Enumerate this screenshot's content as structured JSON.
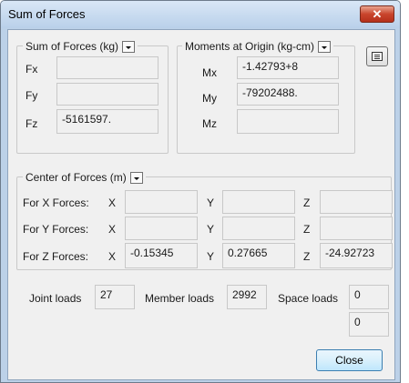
{
  "window": {
    "title": "Sum of Forces",
    "close_glyph": "✕",
    "close_button_label": "Close"
  },
  "sum_forces": {
    "title": "Sum of Forces (kg)",
    "rows": [
      {
        "label": "Fx",
        "value": ""
      },
      {
        "label": "Fy",
        "value": ""
      },
      {
        "label": "Fz",
        "value": "-5161597."
      }
    ]
  },
  "moments": {
    "title": "Moments at Origin (kg-cm)",
    "rows": [
      {
        "label": "Mx",
        "value": "-1.42793+8"
      },
      {
        "label": "My",
        "value": "-79202488."
      },
      {
        "label": "Mz",
        "value": ""
      }
    ]
  },
  "center": {
    "title": "Center of Forces (m)",
    "axis_x": "X",
    "axis_y": "Y",
    "axis_z": "Z",
    "rows": [
      {
        "label": "For X Forces:",
        "x": "",
        "y": "",
        "z": ""
      },
      {
        "label": "For Y Forces:",
        "x": "",
        "y": "",
        "z": ""
      },
      {
        "label": "For Z Forces:",
        "x": "-0.15345",
        "y": "0.27665",
        "z": "-24.92723"
      }
    ]
  },
  "loads": {
    "joint_label": "Joint loads",
    "joint_value": "27",
    "member_label": "Member loads",
    "member_value": "2992",
    "space_label": "Space loads",
    "space_value": "0",
    "space_value_2": "0"
  },
  "icons": {
    "dropdown": "chevron-down-icon",
    "list": "list-icon"
  }
}
